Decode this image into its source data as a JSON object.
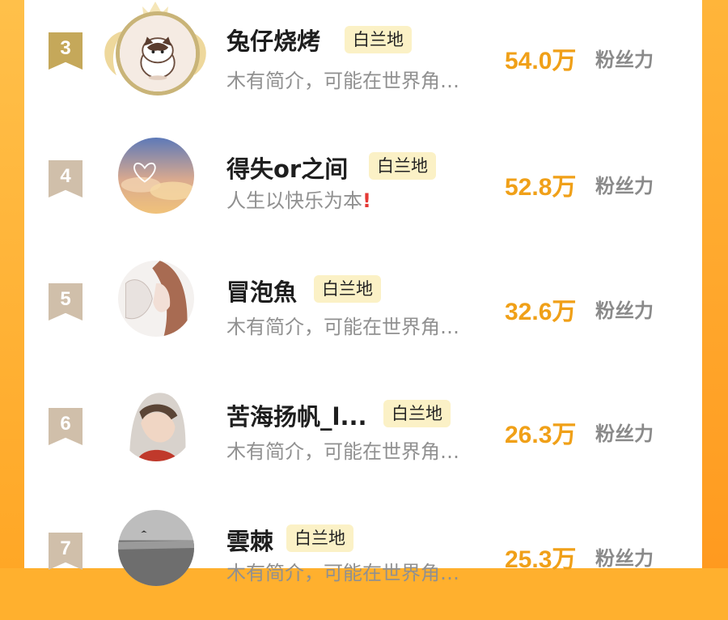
{
  "rows": [
    {
      "rank": "3",
      "name": "兔仔烧烤",
      "tag": "白兰地",
      "bio": "木有简介，可能在世界角…",
      "fans": "54.0",
      "fans_unit": "万",
      "fans_label": "粉丝力"
    },
    {
      "rank": "4",
      "name": "得失or之间",
      "tag": "白兰地",
      "bio": "人生以快乐为本",
      "bio_mark": "!",
      "fans": "52.8",
      "fans_unit": "万",
      "fans_label": "粉丝力"
    },
    {
      "rank": "5",
      "name": "冒泡魚",
      "tag": "白兰地",
      "bio": "木有简介，可能在世界角…",
      "fans": "32.6",
      "fans_unit": "万",
      "fans_label": "粉丝力"
    },
    {
      "rank": "6",
      "name": "苦海扬帆_l...",
      "tag": "白兰地",
      "bio": "木有简介，可能在世界角…",
      "fans": "26.3",
      "fans_unit": "万",
      "fans_label": "粉丝力"
    },
    {
      "rank": "7",
      "name": "雲棘",
      "tag": "白兰地",
      "bio": "木有简介，可能在世界角…",
      "fans": "25.3",
      "fans_unit": "万",
      "fans_label": "粉丝力"
    }
  ],
  "colors": {
    "accent": "#f0a018",
    "tag_bg": "#fbf1c6",
    "badge": "#d0bfaa",
    "badge_top": "#c5a85a",
    "bg": "#ffb02e"
  },
  "icons": {
    "crown": "laurel-crown-icon",
    "rank_badge": "ribbon-badge-icon"
  }
}
